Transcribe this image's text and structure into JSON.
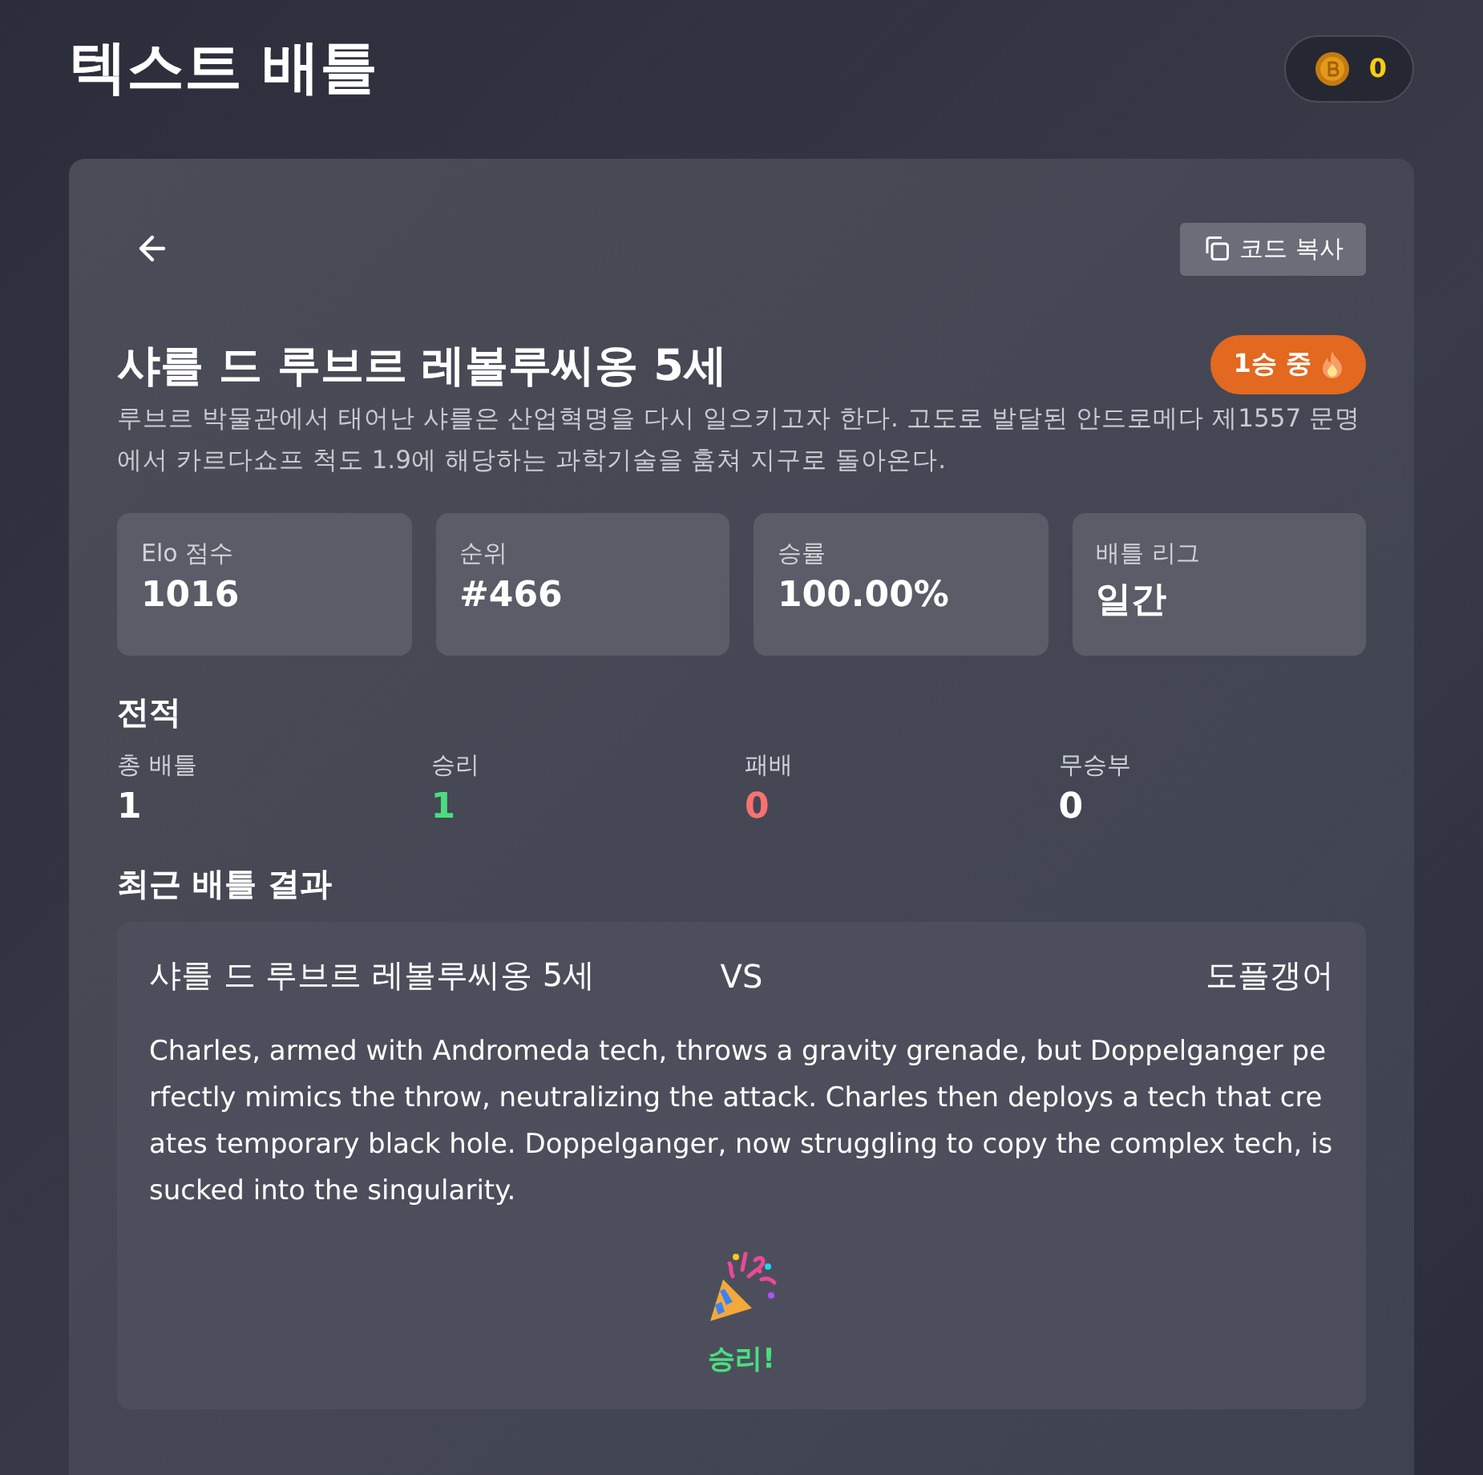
{
  "app_title": "텍스트 배틀",
  "coins": "0",
  "copy_button": "코드 복사",
  "character": {
    "name": "샤를 드 루브르 레볼루씨옹 5세",
    "streak": "1승 중",
    "description": "루브르 박물관에서 태어난 샤를은 산업혁명을 다시 일으키고자 한다. 고도로 발달된 안드로메다 제1557 문명에서 카르다쇼프 척도 1.9에 해당하는 과학기술을 훔쳐 지구로 돌아온다."
  },
  "stats": [
    {
      "label": "Elo 점수",
      "value": "1016"
    },
    {
      "label": "순위",
      "value": "#466"
    },
    {
      "label": "승률",
      "value": "100.00%"
    },
    {
      "label": "배틀 리그",
      "value": "일간"
    }
  ],
  "record_title": "전적",
  "record": [
    {
      "label": "총 배틀",
      "value": "1",
      "color": "#ffffff"
    },
    {
      "label": "승리",
      "value": "1",
      "color": "#4ade80"
    },
    {
      "label": "패배",
      "value": "0",
      "color": "#f87171"
    },
    {
      "label": "무승부",
      "value": "0",
      "color": "#ffffff"
    }
  ],
  "recent_title": "최근 배틀 결과",
  "battle": {
    "player": "샤를 드 루브르 레볼루씨옹 5세",
    "vs": "VS",
    "opponent": "도플갱어",
    "story": "Charles, armed with Andromeda tech, throws a gravity grenade, but Doppelganger perfectly mimics the throw, neutralizing the attack. Charles then deploys a tech that creates temporary black hole. Doppelganger, now struggling to copy the complex tech, is sucked into the singularity.",
    "result": "승리!",
    "won": true
  }
}
